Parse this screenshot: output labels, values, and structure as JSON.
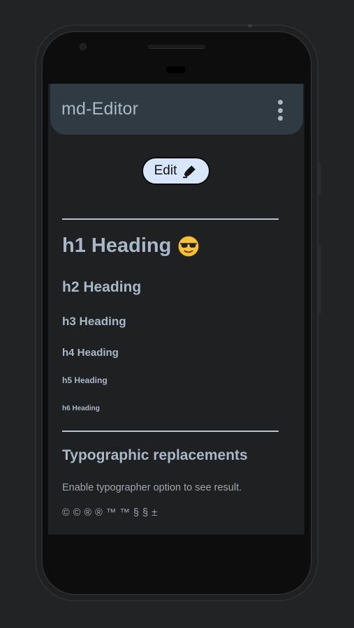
{
  "app": {
    "title": "md-Editor"
  },
  "toolbar": {
    "edit_label": "Edit",
    "edit_icon": "marker-pen-icon",
    "menu_icon": "more-vert-icon"
  },
  "preview": {
    "h1": "h1 Heading",
    "h1_emoji": "sunglasses-emoji-icon",
    "h2": "h2 Heading",
    "h3": "h3 Heading",
    "h4": "h4 Heading",
    "h5": "h5 Heading",
    "h6": "h6 Heading",
    "section_title": "Typographic replacements",
    "paragraph": "Enable typographer option to see result.",
    "symbols": "© © ® ® ™ ™ § § ±"
  },
  "colors": {
    "background": "#222324",
    "screen": "#1f2022",
    "appbar": "#2f3a42",
    "text": "#a9b8c6",
    "button": "#d7e6fb"
  }
}
